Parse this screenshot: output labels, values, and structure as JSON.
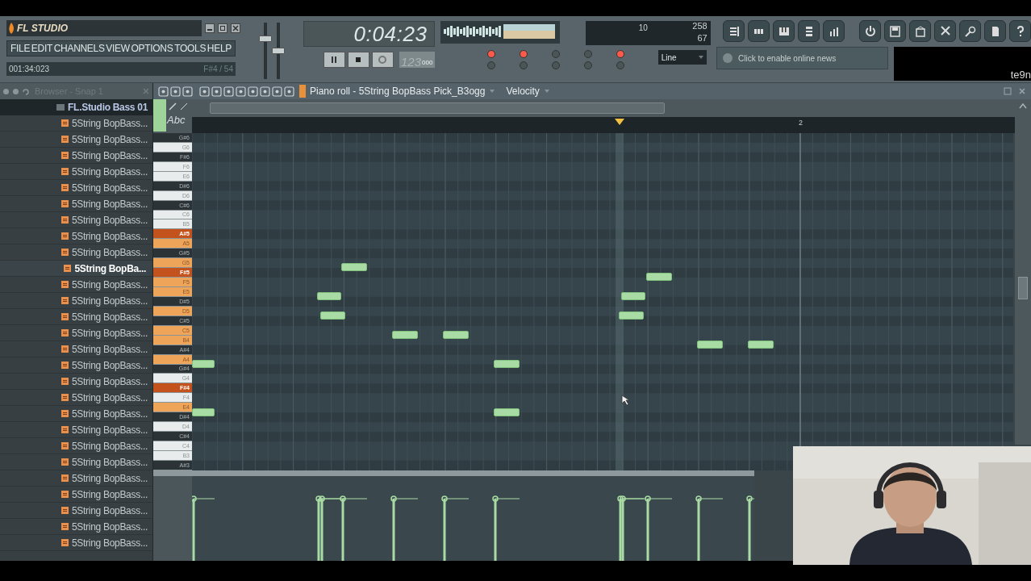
{
  "app": {
    "logo": "FL STUDIO",
    "menu": [
      "FILE",
      "EDIT",
      "CHANNELS",
      "VIEW",
      "OPTIONS",
      "TOOLS",
      "HELP"
    ],
    "hint_left": "001:34:023",
    "hint_right": "F#4 / 54"
  },
  "sliders": [
    {
      "level": 0.75
    },
    {
      "level": 0.5
    }
  ],
  "transport": {
    "time": "0:04:23",
    "tempo": "123",
    "tempo_fraction": "000",
    "snap_mode": "Line"
  },
  "switches": [
    {
      "on": true
    },
    {
      "on": false
    },
    {
      "on": true
    },
    {
      "on": false
    },
    {
      "on": false
    },
    {
      "on": false
    },
    {
      "on": false
    },
    {
      "on": false
    },
    {
      "on": true
    },
    {
      "on": false
    }
  ],
  "cpu": {
    "polyphony": "10",
    "memory": "258",
    "cpu": "67"
  },
  "news": {
    "text": "Click to enable online news"
  },
  "corner_text": "te9n",
  "browser": {
    "title": "Browser - Snap 1",
    "folder": "FL.Studio Bass 01",
    "items": [
      {
        "label": "5String BopBass...",
        "selected": false
      },
      {
        "label": "5String BopBass...",
        "selected": false
      },
      {
        "label": "5String BopBass...",
        "selected": false
      },
      {
        "label": "5String BopBass...",
        "selected": false
      },
      {
        "label": "5String BopBass...",
        "selected": false
      },
      {
        "label": "5String BopBass...",
        "selected": false
      },
      {
        "label": "5String BopBass...",
        "selected": false
      },
      {
        "label": "5String BopBass...",
        "selected": false
      },
      {
        "label": "5String BopBass...",
        "selected": false
      },
      {
        "label": "5String BopBa...",
        "selected": true
      },
      {
        "label": "5String BopBass...",
        "selected": false
      },
      {
        "label": "5String BopBass...",
        "selected": false
      },
      {
        "label": "5String BopBass...",
        "selected": false
      },
      {
        "label": "5String BopBass...",
        "selected": false
      },
      {
        "label": "5String BopBass...",
        "selected": false
      },
      {
        "label": "5String BopBass...",
        "selected": false
      },
      {
        "label": "5String BopBass...",
        "selected": false
      },
      {
        "label": "5String BopBass...",
        "selected": false
      },
      {
        "label": "5String BopBass...",
        "selected": false
      },
      {
        "label": "5String BopBass...",
        "selected": false
      },
      {
        "label": "5String BopBass...",
        "selected": false
      },
      {
        "label": "5String BopBass...",
        "selected": false
      },
      {
        "label": "5String BopBass...",
        "selected": false
      },
      {
        "label": "5String BopBass...",
        "selected": false
      },
      {
        "label": "5String BopBass...",
        "selected": false
      },
      {
        "label": "5String BopBass...",
        "selected": false
      },
      {
        "label": "5String BopBass...",
        "selected": false
      }
    ]
  },
  "piano_roll": {
    "title": "Piano roll - 5String BopBass Pick_B3ogg",
    "target": "Velocity",
    "tool_label": "Abc",
    "ruler": [
      "2"
    ],
    "keys": [
      {
        "label": "G#6",
        "black": true
      },
      {
        "label": "G6",
        "black": false
      },
      {
        "label": "F#6",
        "black": true
      },
      {
        "label": "F6",
        "black": false
      },
      {
        "label": "E6",
        "black": false
      },
      {
        "label": "D#6",
        "black": true
      },
      {
        "label": "D6",
        "black": false
      },
      {
        "label": "C#6",
        "black": true
      },
      {
        "label": "C6",
        "black": false
      },
      {
        "label": "B5",
        "black": false
      },
      {
        "label": "A#5",
        "black": true,
        "color": "#c4521c"
      },
      {
        "label": "A5",
        "black": false,
        "color": "#eea55a"
      },
      {
        "label": "G#5",
        "black": true
      },
      {
        "label": "G5",
        "black": false,
        "color": "#eea55a"
      },
      {
        "label": "F#5",
        "black": true,
        "color": "#c4521c"
      },
      {
        "label": "F5",
        "black": false,
        "color": "#eea55a"
      },
      {
        "label": "E5",
        "black": false,
        "color": "#eea55a"
      },
      {
        "label": "D#5",
        "black": true
      },
      {
        "label": "D5",
        "black": false,
        "color": "#eea55a"
      },
      {
        "label": "C#5",
        "black": true
      },
      {
        "label": "C5",
        "black": false,
        "color": "#eea55a"
      },
      {
        "label": "B4",
        "black": false,
        "color": "#eea55a"
      },
      {
        "label": "A#4",
        "black": true
      },
      {
        "label": "A4",
        "black": false,
        "color": "#eea55a"
      },
      {
        "label": "G#4",
        "black": true
      },
      {
        "label": "G4",
        "black": false
      },
      {
        "label": "F#4",
        "black": true,
        "color": "#c4521c"
      },
      {
        "label": "F4",
        "black": false
      },
      {
        "label": "E4",
        "black": false,
        "color": "#eea55a"
      },
      {
        "label": "D#4",
        "black": true
      },
      {
        "label": "D4",
        "black": false
      },
      {
        "label": "C#4",
        "black": true
      },
      {
        "label": "C4",
        "black": false
      },
      {
        "label": "B3",
        "black": false
      },
      {
        "label": "A#3",
        "black": true
      }
    ]
  }
}
